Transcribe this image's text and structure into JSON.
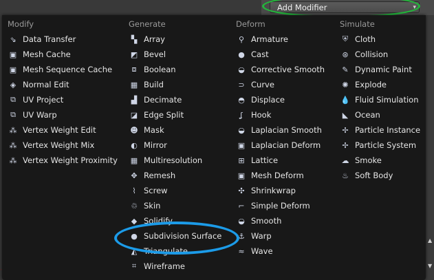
{
  "header": {
    "add_modifier_label": "Add Modifier"
  },
  "columns": [
    {
      "key": "modify",
      "heading": "Modify",
      "items": [
        {
          "label": "Data Transfer",
          "icon": "data-transfer-icon",
          "glyph": "⇘"
        },
        {
          "label": "Mesh Cache",
          "icon": "mesh-cache-icon",
          "glyph": "▣"
        },
        {
          "label": "Mesh Sequence Cache",
          "icon": "mesh-sequence-cache-icon",
          "glyph": "▣"
        },
        {
          "label": "Normal Edit",
          "icon": "normal-edit-icon",
          "glyph": "◈"
        },
        {
          "label": "UV Project",
          "icon": "uv-project-icon",
          "glyph": "⧉"
        },
        {
          "label": "UV Warp",
          "icon": "uv-warp-icon",
          "glyph": "⧉"
        },
        {
          "label": "Vertex Weight Edit",
          "icon": "vertex-weight-edit-icon",
          "glyph": "⁂"
        },
        {
          "label": "Vertex Weight Mix",
          "icon": "vertex-weight-mix-icon",
          "glyph": "⁂"
        },
        {
          "label": "Vertex Weight Proximity",
          "icon": "vertex-weight-proximity-icon",
          "glyph": "⁂"
        }
      ]
    },
    {
      "key": "generate",
      "heading": "Generate",
      "items": [
        {
          "label": "Array",
          "icon": "array-icon",
          "glyph": "▚"
        },
        {
          "label": "Bevel",
          "icon": "bevel-icon",
          "glyph": "◩"
        },
        {
          "label": "Boolean",
          "icon": "boolean-icon",
          "glyph": "⧈"
        },
        {
          "label": "Build",
          "icon": "build-icon",
          "glyph": "▦"
        },
        {
          "label": "Decimate",
          "icon": "decimate-icon",
          "glyph": "▟"
        },
        {
          "label": "Edge Split",
          "icon": "edge-split-icon",
          "glyph": "◪"
        },
        {
          "label": "Mask",
          "icon": "mask-icon",
          "glyph": "☻"
        },
        {
          "label": "Mirror",
          "icon": "mirror-icon",
          "glyph": "◐"
        },
        {
          "label": "Multiresolution",
          "icon": "multiresolution-icon",
          "glyph": "▦"
        },
        {
          "label": "Remesh",
          "icon": "remesh-icon",
          "glyph": "✥"
        },
        {
          "label": "Screw",
          "icon": "screw-icon",
          "glyph": "⌇"
        },
        {
          "label": "Skin",
          "icon": "skin-icon",
          "glyph": "♲"
        },
        {
          "label": "Solidify",
          "icon": "solidify-icon",
          "glyph": "◆"
        },
        {
          "label": "Subdivision Surface",
          "icon": "subdivision-surface-icon",
          "glyph": "●"
        },
        {
          "label": "Triangulate",
          "icon": "triangulate-icon",
          "glyph": "◭"
        },
        {
          "label": "Wireframe",
          "icon": "wireframe-icon",
          "glyph": "⌗"
        }
      ]
    },
    {
      "key": "deform",
      "heading": "Deform",
      "items": [
        {
          "label": "Armature",
          "icon": "armature-icon",
          "glyph": "⚲"
        },
        {
          "label": "Cast",
          "icon": "cast-icon",
          "glyph": "●"
        },
        {
          "label": "Corrective Smooth",
          "icon": "corrective-smooth-icon",
          "glyph": "◒"
        },
        {
          "label": "Curve",
          "icon": "curve-icon",
          "glyph": "⊃"
        },
        {
          "label": "Displace",
          "icon": "displace-icon",
          "glyph": "◓"
        },
        {
          "label": "Hook",
          "icon": "hook-icon",
          "glyph": "ʆ"
        },
        {
          "label": "Laplacian Smooth",
          "icon": "laplacian-smooth-icon",
          "glyph": "◒"
        },
        {
          "label": "Laplacian Deform",
          "icon": "laplacian-deform-icon",
          "glyph": "▣"
        },
        {
          "label": "Lattice",
          "icon": "lattice-icon",
          "glyph": "⊞"
        },
        {
          "label": "Mesh Deform",
          "icon": "mesh-deform-icon",
          "glyph": "▣"
        },
        {
          "label": "Shrinkwrap",
          "icon": "shrinkwrap-icon",
          "glyph": "✣"
        },
        {
          "label": "Simple Deform",
          "icon": "simple-deform-icon",
          "glyph": "⌐"
        },
        {
          "label": "Smooth",
          "icon": "smooth-icon",
          "glyph": "◒"
        },
        {
          "label": "Warp",
          "icon": "warp-icon",
          "glyph": "⚓"
        },
        {
          "label": "Wave",
          "icon": "wave-icon",
          "glyph": "≈"
        }
      ]
    },
    {
      "key": "simulate",
      "heading": "Simulate",
      "items": [
        {
          "label": "Cloth",
          "icon": "cloth-icon",
          "glyph": "⛨"
        },
        {
          "label": "Collision",
          "icon": "collision-icon",
          "glyph": "⊛"
        },
        {
          "label": "Dynamic Paint",
          "icon": "dynamic-paint-icon",
          "glyph": "✎"
        },
        {
          "label": "Explode",
          "icon": "explode-icon",
          "glyph": "✺"
        },
        {
          "label": "Fluid Simulation",
          "icon": "fluid-simulation-icon",
          "glyph": "💧"
        },
        {
          "label": "Ocean",
          "icon": "ocean-icon",
          "glyph": "◣"
        },
        {
          "label": "Particle Instance",
          "icon": "particle-instance-icon",
          "glyph": "✢"
        },
        {
          "label": "Particle System",
          "icon": "particle-system-icon",
          "glyph": "✢"
        },
        {
          "label": "Smoke",
          "icon": "smoke-icon",
          "glyph": "☁"
        },
        {
          "label": "Soft Body",
          "icon": "soft-body-icon",
          "glyph": "♨"
        }
      ]
    }
  ],
  "highlight": {
    "green_ring_color": "#23b53b",
    "blue_ring_color": "#1c9be8"
  }
}
